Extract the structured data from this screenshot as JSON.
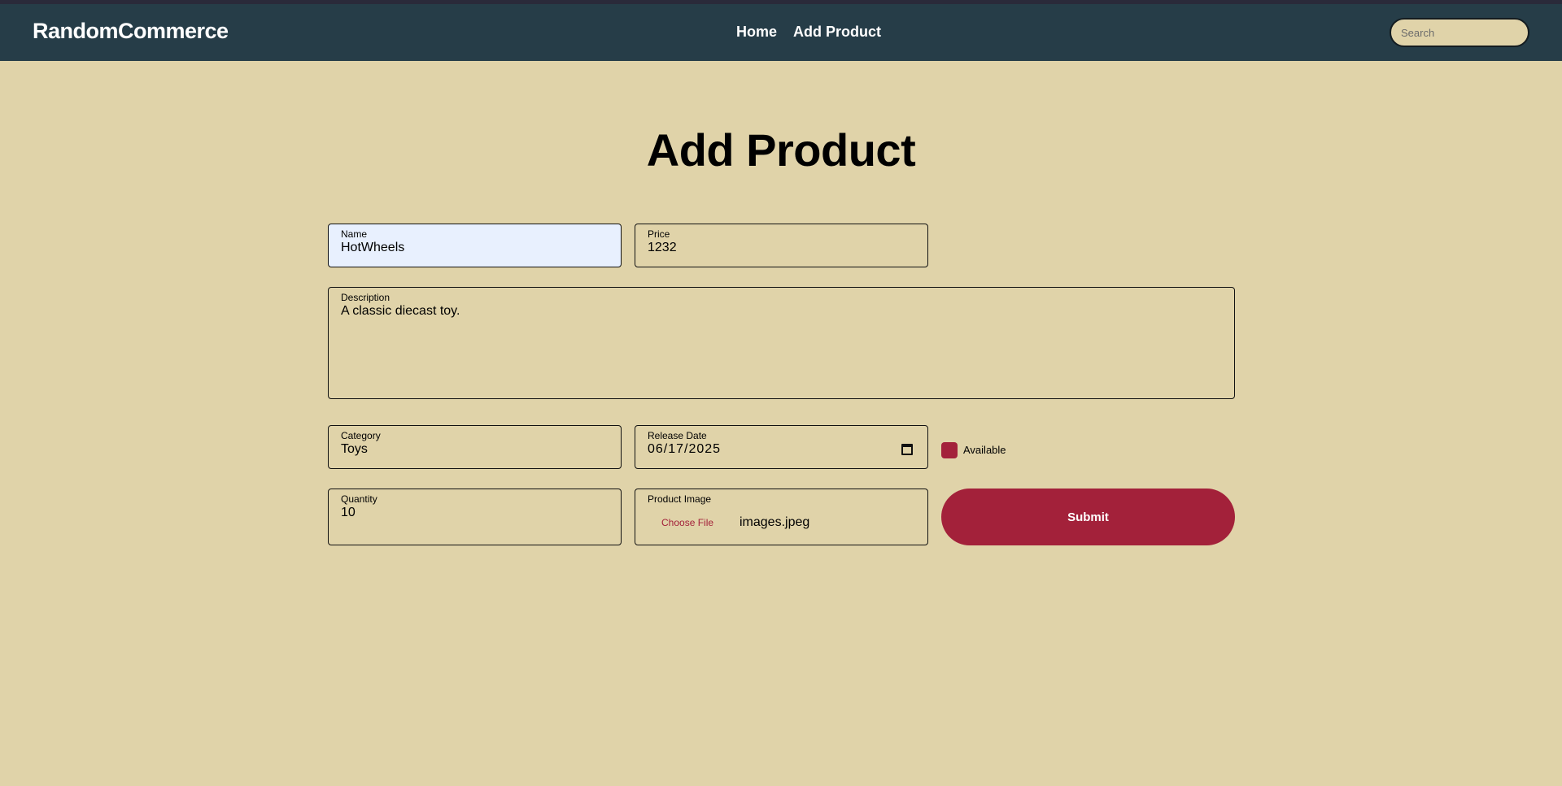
{
  "header": {
    "brand": "RandomCommerce",
    "nav": [
      "Home",
      "Add Product"
    ],
    "search_placeholder": "Search"
  },
  "page": {
    "title": "Add Product"
  },
  "form": {
    "name": {
      "label": "Name",
      "value": "HotWheels"
    },
    "price": {
      "label": "Price",
      "value": "1232"
    },
    "description": {
      "label": "Description",
      "value": "A classic diecast toy."
    },
    "category": {
      "label": "Category",
      "value": "Toys"
    },
    "release_date": {
      "label": "Release Date",
      "value": "06/17/2025"
    },
    "available": {
      "label": "Available",
      "checked": true
    },
    "quantity": {
      "label": "Quantity",
      "value": "10"
    },
    "image": {
      "label": "Product Image",
      "button": "Choose File",
      "file_name": "images.jpeg"
    },
    "submit_label": "Submit"
  },
  "colors": {
    "background": "#e0d3a9",
    "navbar": "#263d48",
    "accent": "#a3213a",
    "focused_input": "#e8f0fe"
  }
}
